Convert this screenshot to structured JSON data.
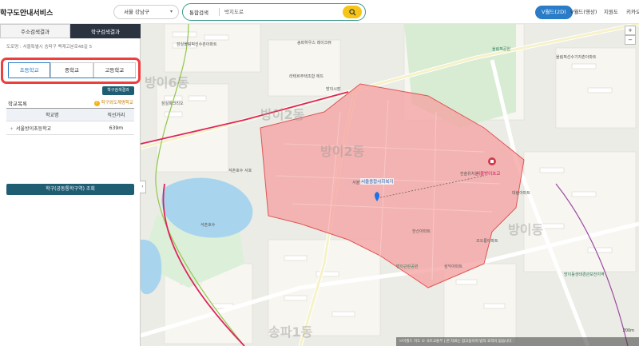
{
  "header": {
    "app_title": "학구도안내서비스",
    "region_select": "서울 강남구",
    "search_type": "통합검색",
    "search_placeholder": "박지도로",
    "menu": [
      {
        "label": "V월드(2D)",
        "active": true
      },
      {
        "label": "V월드(영상)",
        "active": false
      },
      {
        "label": "지원도",
        "active": false
      },
      {
        "label": "키카오",
        "active": false
      }
    ]
  },
  "panel": {
    "tabs": [
      {
        "label": "주소검색결과",
        "active": false
      },
      {
        "label": "학구검색결과",
        "active": true
      }
    ],
    "address": "도로명 : 서울특별시 송파구 백제고분로48길 5",
    "address_sub": "",
    "school_tabs": [
      {
        "label": "초등학교",
        "active": true
      },
      {
        "label": "중학교",
        "active": false
      },
      {
        "label": "고등학교",
        "active": false
      }
    ],
    "peek_text": "",
    "peek_button": "학구검색결과",
    "list_title": "학교목록",
    "list_note_icon": "?",
    "list_note": "학구외도계명학교",
    "table": {
      "headers": [
        "학교명",
        "직선거리"
      ],
      "rows": [
        {
          "name": "서울방이초등학교",
          "distance": "639m"
        }
      ]
    },
    "lookup_button": "학구(공동통학구역) 조회",
    "collapse_icon": "‹"
  },
  "map": {
    "dong_labels": [
      "방이2동",
      "방이2동",
      "방이동",
      "송파1동",
      "방이6동"
    ],
    "labels": [
      "잠실올림픽선수촌아파트",
      "송파하우스 레이크뷰",
      "올림픽공원",
      "올림픽선수기자촌아파트",
      "라테르주택조합 에뜨",
      "방이시장",
      "잠실파크리오",
      "석촌호수",
      "서울방이초등학교",
      "한솔유치원",
      "대림아파트",
      "한신아파트",
      "코오롱아파트",
      "삼익아파트",
      "석촌호수 서호",
      "방이근린공원",
      "방이동생태경관보전지역"
    ],
    "school_marker_label": "서울방이초교",
    "origin_label": "서울종합사회복지",
    "zoom_in": "+",
    "zoom_out": "−",
    "footer": "브이월드 지도 © 국토교통부 | 본 자료는 참고용이며 법적 효력이 없습니다",
    "scale": "200m"
  },
  "colors": {
    "accent": "#2a7cc7",
    "school_zone_fill": "#f5a3a3",
    "school_zone_stroke": "#e05555",
    "highlight": "#ee3f3f",
    "dark_button": "#1f5d73",
    "search_button": "#f5c518"
  }
}
